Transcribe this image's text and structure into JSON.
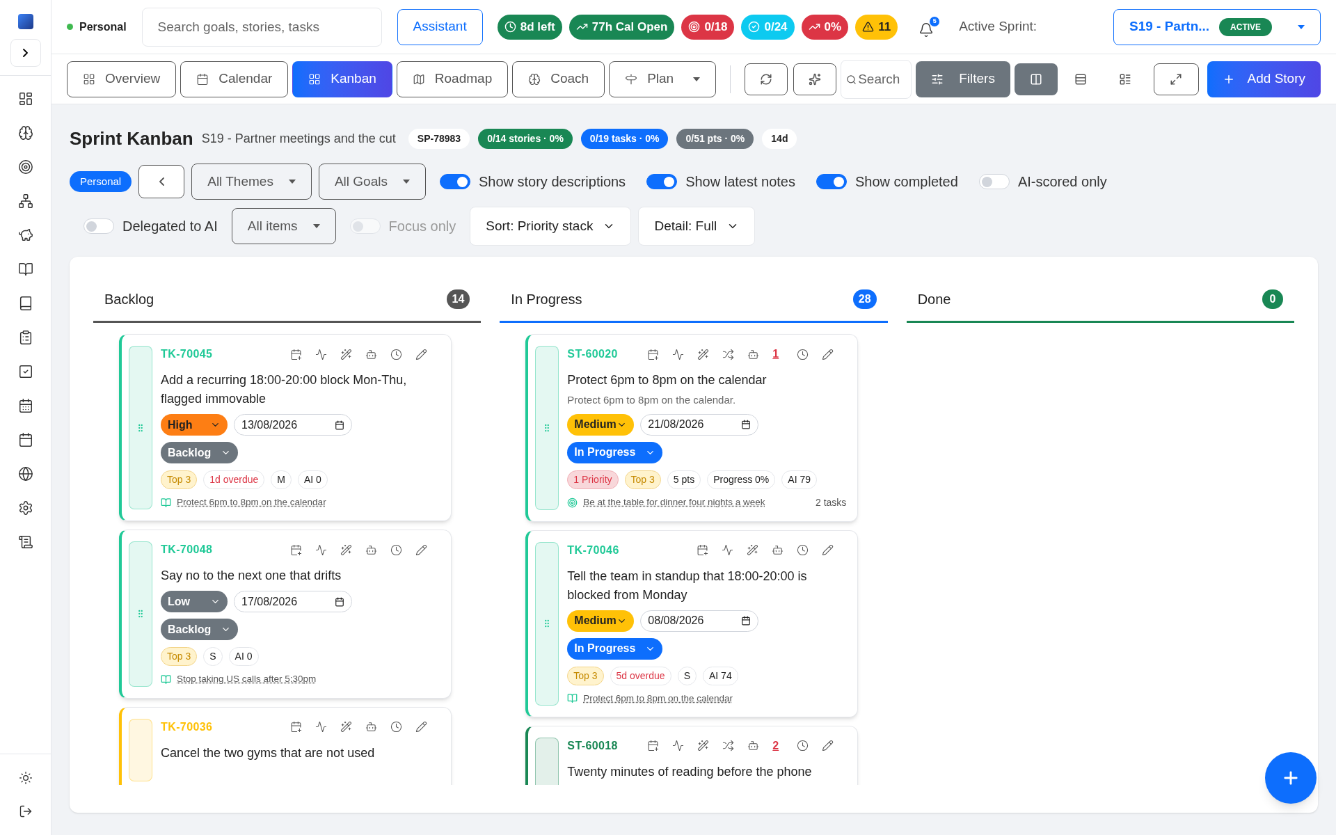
{
  "topbar": {
    "workspace": "Personal",
    "search": {
      "placeholder": "Search goals, stories, tasks"
    },
    "assistant": "Assistant",
    "stats": [
      {
        "kind": "time",
        "label": "8d left",
        "color": "#198754"
      },
      {
        "kind": "trend",
        "label": "77h Cal Open",
        "color": "#198754"
      },
      {
        "kind": "target",
        "label": "0/18",
        "color": "#dc3545"
      },
      {
        "kind": "check",
        "label": "0/24",
        "color": "#0dcaf0"
      },
      {
        "kind": "trend",
        "label": "0%",
        "color": "#dc3545"
      },
      {
        "kind": "warning",
        "label": "11",
        "color": "#ffc107"
      }
    ],
    "notifications": "5",
    "sprint_label": "Active Sprint:",
    "sprint": {
      "name": "S19 - Partn...",
      "status": "ACTIVE"
    }
  },
  "toolbar": {
    "views": [
      {
        "kind": "overview",
        "label": "Overview",
        "selected": false
      },
      {
        "kind": "calendar",
        "label": "Calendar",
        "selected": false
      },
      {
        "kind": "kanban",
        "label": "Kanban",
        "selected": true
      },
      {
        "kind": "roadmap",
        "label": "Roadmap",
        "selected": false
      },
      {
        "kind": "coach",
        "label": "Coach",
        "selected": false
      },
      {
        "kind": "plan",
        "label": "Plan",
        "selected": false
      }
    ],
    "search": {
      "placeholder": "Search"
    },
    "filters": "Filters",
    "layouts": [
      {
        "kind": "columns",
        "selected": true
      },
      {
        "kind": "rows",
        "selected": false
      },
      {
        "kind": "list",
        "selected": false
      }
    ],
    "add": "Add Story"
  },
  "heading": {
    "title": "Sprint Kanban",
    "subtitle": "S19 - Partner meetings and the cut",
    "badges": [
      {
        "kind": "plain",
        "label": "SP-78983"
      },
      {
        "kind": "success",
        "label": "0/14 stories · 0%"
      },
      {
        "kind": "primary",
        "label": "0/19 tasks · 0%"
      },
      {
        "kind": "secondary",
        "label": "0/51 pts · 0%"
      },
      {
        "kind": "plain",
        "label": "14d"
      }
    ]
  },
  "filter_rows": [
    [
      {
        "kind": "pill",
        "label": "Personal"
      },
      {
        "kind": "back"
      },
      {
        "kind": "select",
        "label": "All Themes"
      },
      {
        "kind": "select",
        "label": "All Goals"
      },
      {
        "kind": "toggle",
        "label": "Show story descriptions",
        "on": true,
        "disabled": false
      },
      {
        "kind": "toggle",
        "label": "Show latest notes",
        "on": true,
        "disabled": false
      },
      {
        "kind": "toggle",
        "label": "Show completed",
        "on": true,
        "disabled": false
      },
      {
        "kind": "toggle",
        "label": "AI-scored only",
        "on": false,
        "disabled": false
      }
    ],
    [
      {
        "kind": "toggle",
        "label": "Delegated to AI",
        "on": false,
        "disabled": false
      },
      {
        "kind": "select",
        "label": "All items"
      },
      {
        "kind": "toggle",
        "label": "Focus only",
        "on": false,
        "disabled": true
      },
      {
        "kind": "menu",
        "label": "Sort: Priority stack"
      },
      {
        "kind": "menu",
        "label": "Detail: Full"
      }
    ]
  ],
  "columns": [
    {
      "name": "Backlog",
      "count": "14",
      "color": "#555555",
      "cards": [
        {
          "kind": "task",
          "id": "TK-70045",
          "color": "#20c997",
          "title": "Add a recurring 18:00-20:00 block Mon-Thu, flagged immovable",
          "priority": {
            "kind": "high",
            "label": "High"
          },
          "due": "13/08/2026",
          "status": {
            "kind": "backlog",
            "label": "Backlog"
          },
          "tags": [
            {
              "kind": "top",
              "label": "Top 3"
            },
            {
              "kind": "overdue",
              "label": "1d overdue"
            },
            {
              "kind": "plain",
              "label": "M"
            },
            {
              "kind": "plain",
              "label": "AI 0"
            }
          ],
          "link": {
            "kind": "story",
            "text": "Protect 6pm to 8pm on the calendar"
          }
        },
        {
          "kind": "task",
          "id": "TK-70048",
          "color": "#20c997",
          "title": "Say no to the next one that drifts",
          "priority": {
            "kind": "low",
            "label": "Low"
          },
          "due": "17/08/2026",
          "status": {
            "kind": "backlog",
            "label": "Backlog"
          },
          "tags": [
            {
              "kind": "top",
              "label": "Top 3"
            },
            {
              "kind": "plain",
              "label": "S"
            },
            {
              "kind": "plain",
              "label": "AI 0"
            }
          ],
          "link": {
            "kind": "story",
            "text": "Stop taking US calls after 5:30pm"
          }
        },
        {
          "kind": "task",
          "id": "TK-70036",
          "color": "#ffc107",
          "title": "Cancel the two gyms that are not used"
        }
      ]
    },
    {
      "name": "In Progress",
      "count": "28",
      "color": "#0d6efd",
      "cards": [
        {
          "kind": "story",
          "id": "ST-60020",
          "color": "#20c997",
          "alert": "1",
          "title": "Protect 6pm to 8pm on the calendar",
          "description": "Protect 6pm to 8pm on the calendar.",
          "priority": {
            "kind": "medium",
            "label": "Medium"
          },
          "due": "21/08/2026",
          "status": {
            "kind": "in_progress",
            "label": "In Progress"
          },
          "tags": [
            {
              "kind": "priority",
              "label": "1 Priority"
            },
            {
              "kind": "top",
              "label": "Top 3"
            },
            {
              "kind": "plain",
              "label": "5 pts"
            },
            {
              "kind": "plain",
              "label": "Progress 0%"
            },
            {
              "kind": "plain",
              "label": "AI 79"
            }
          ],
          "link": {
            "kind": "goal",
            "text": "Be at the table for dinner four nights a week"
          },
          "tasks": "2 tasks"
        },
        {
          "kind": "task",
          "id": "TK-70046",
          "color": "#20c997",
          "title": "Tell the team in standup that 18:00-20:00 is blocked from Monday",
          "priority": {
            "kind": "medium",
            "label": "Medium"
          },
          "due": "08/08/2026",
          "status": {
            "kind": "in_progress",
            "label": "In Progress"
          },
          "tags": [
            {
              "kind": "top",
              "label": "Top 3"
            },
            {
              "kind": "overdue",
              "label": "5d overdue"
            },
            {
              "kind": "plain",
              "label": "S"
            },
            {
              "kind": "plain",
              "label": "AI 74"
            }
          ],
          "link": {
            "kind": "story",
            "text": "Protect 6pm to 8pm on the calendar"
          }
        },
        {
          "kind": "story",
          "id": "ST-60018",
          "color": "#198754",
          "alert": "2",
          "title": "Twenty minutes of reading before the phone"
        }
      ]
    },
    {
      "name": "Done",
      "count": "0",
      "color": "#198754"
    }
  ]
}
